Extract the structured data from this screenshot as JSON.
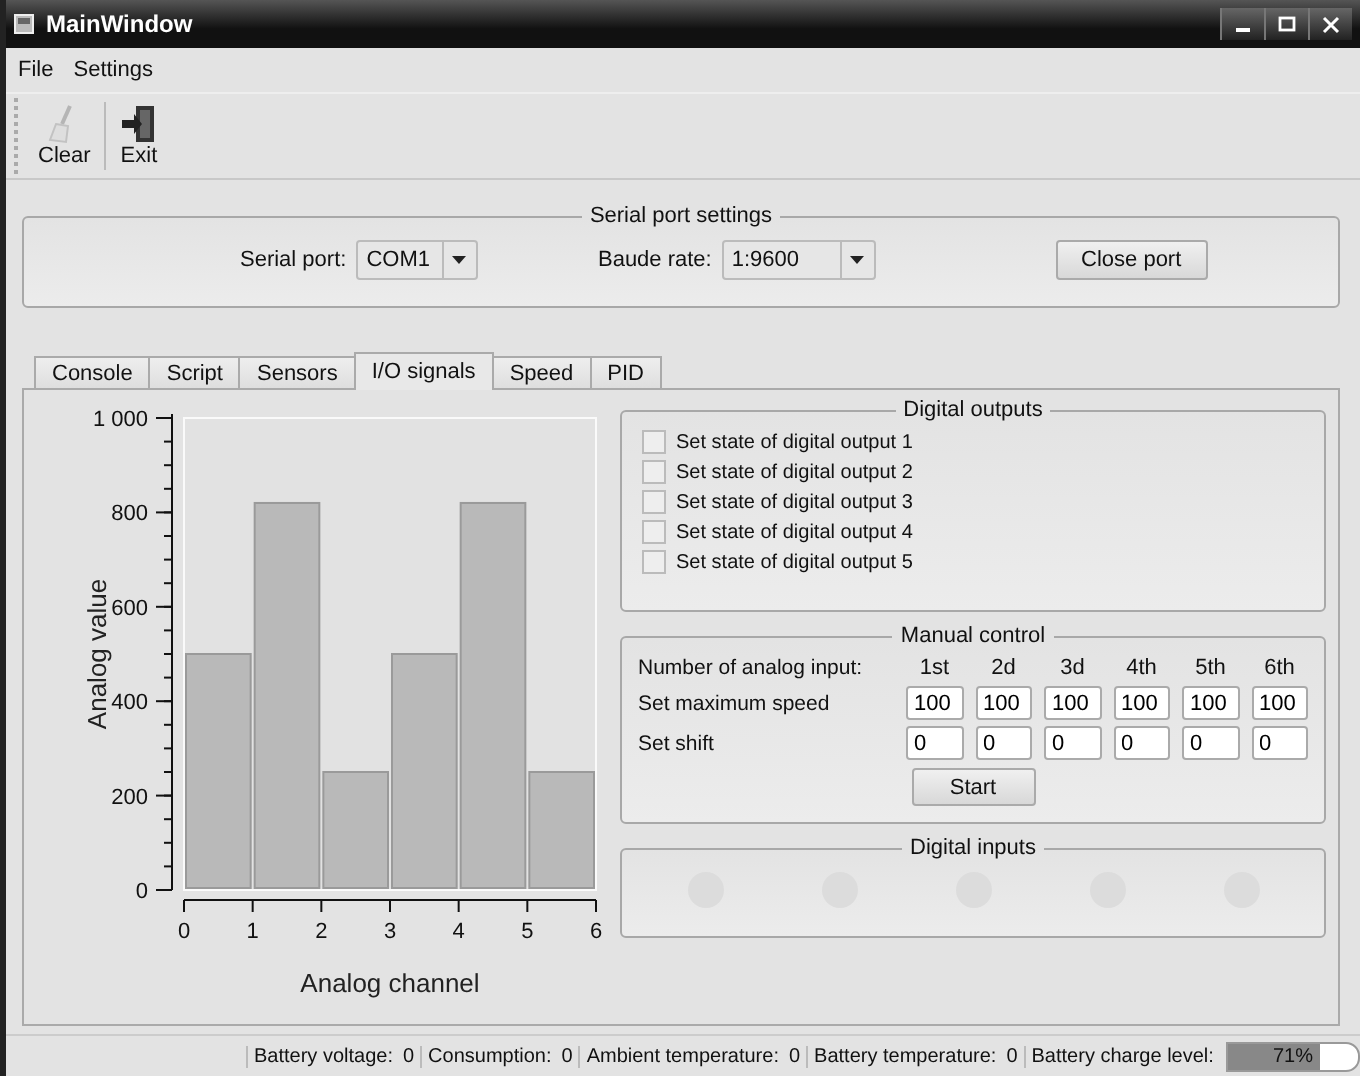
{
  "window": {
    "title": "MainWindow"
  },
  "menu": [
    {
      "label": "File"
    },
    {
      "label": "Settings"
    }
  ],
  "toolbar": [
    {
      "label": "Clear",
      "kind": "clear",
      "disabled": true
    },
    {
      "label": "Exit",
      "kind": "exit",
      "disabled": false
    }
  ],
  "serial_settings": {
    "title": "Serial port settings",
    "port_label": "Serial port:",
    "port_value": "COM1",
    "baud_label": "Baude rate:",
    "baud_value": "1:9600",
    "button": "Close port"
  },
  "tabs": [
    {
      "label": "Console",
      "selected": false
    },
    {
      "label": "Script",
      "selected": false
    },
    {
      "label": "Sensors",
      "selected": false
    },
    {
      "label": "I/O signals",
      "selected": true
    },
    {
      "label": "Speed",
      "selected": false
    },
    {
      "label": "PID",
      "selected": false
    }
  ],
  "chart": {
    "chart_data": {
      "type": "bar",
      "xlabel": "Analog channel",
      "ylabel": "Analog value",
      "x": [
        0.5,
        1.5,
        2.5,
        3.5,
        4.5,
        5.5
      ],
      "values": [
        500,
        820,
        250,
        500,
        820,
        250
      ],
      "xlim": [
        0,
        6
      ],
      "ylim": [
        0,
        1000
      ],
      "xticks": [
        0,
        1,
        2,
        3,
        4,
        5,
        6
      ],
      "yticks": [
        0,
        200,
        400,
        600,
        800,
        {
          "value": 1000,
          "label": "1 000"
        }
      ]
    }
  },
  "digital_outputs": {
    "title": "Digital outputs",
    "items": [
      {
        "label": "Set state of digital output 1",
        "checked": false
      },
      {
        "label": "Set state of digital output 2",
        "checked": false
      },
      {
        "label": "Set state of digital output 3",
        "checked": false
      },
      {
        "label": "Set state of digital output 4",
        "checked": false
      },
      {
        "label": "Set state of digital output 5",
        "checked": false
      }
    ]
  },
  "manual_control": {
    "title": "Manual control",
    "header_label": "Number of analog input:",
    "columns": [
      "1st",
      "2d",
      "3d",
      "4th",
      "5th",
      "6th"
    ],
    "rows": [
      {
        "label": "Set maximum speed",
        "values": [
          "100",
          "100",
          "100",
          "100",
          "100",
          "100"
        ]
      },
      {
        "label": "Set shift",
        "values": [
          "0",
          "0",
          "0",
          "0",
          "0",
          "0"
        ]
      }
    ],
    "button": "Start"
  },
  "digital_inputs": {
    "title": "Digital inputs",
    "items": [
      {
        "on": false
      },
      {
        "on": false
      },
      {
        "on": false
      },
      {
        "on": false
      },
      {
        "on": false
      }
    ]
  },
  "status_bar": {
    "items": [
      {
        "label": "Battery voltage:",
        "value": "0"
      },
      {
        "label": "Consumption:",
        "value": "0"
      },
      {
        "label": "Ambient temperature:",
        "value": "0"
      },
      {
        "label": "Battery temperature:",
        "value": "0"
      }
    ],
    "charge": {
      "label": "Battery charge level:",
      "level": 0.71,
      "text": "71%"
    }
  }
}
